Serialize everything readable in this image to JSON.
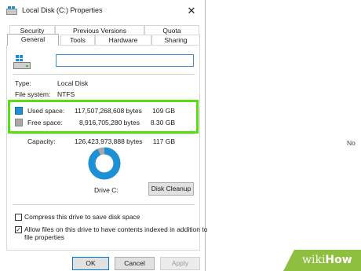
{
  "window": {
    "title": "Local Disk (C:) Properties",
    "close_glyph": "✕"
  },
  "tabs_row1": [
    "Security",
    "Previous Versions",
    "Quota"
  ],
  "tabs_row2": [
    "General",
    "Tools",
    "Hardware",
    "Sharing"
  ],
  "active_tab": "General",
  "drive_name_value": "",
  "info": {
    "type_label": "Type:",
    "type_value": "Local Disk",
    "fs_label": "File system:",
    "fs_value": "NTFS"
  },
  "space": {
    "used_label": "Used space:",
    "used_bytes": "117,507,268,608 bytes",
    "used_gb": "109 GB",
    "free_label": "Free space:",
    "free_bytes": "8,916,705,280 bytes",
    "free_gb": "8.30 GB",
    "capacity_label": "Capacity:",
    "capacity_bytes": "126,423,973,888 bytes",
    "capacity_gb": "117 GB",
    "used_fraction": 0.929
  },
  "drive_label": "Drive C:",
  "disk_cleanup_label": "Disk Cleanup",
  "compress_label": "Compress this drive to save disk space",
  "compress_checked": false,
  "index_label_line1": "Allow files on this drive to have contents indexed in addition to",
  "index_label_line2": "file properties",
  "index_checked": true,
  "buttons": {
    "ok": "OK",
    "cancel": "Cancel",
    "apply": "Apply"
  },
  "side_text": "No",
  "watermark": {
    "wiki": "wiki",
    "how": "How"
  },
  "colors": {
    "used": "#1e90d6",
    "free": "#a8a8a8",
    "highlight": "#56e012",
    "watermark": "#8fbf3f"
  }
}
